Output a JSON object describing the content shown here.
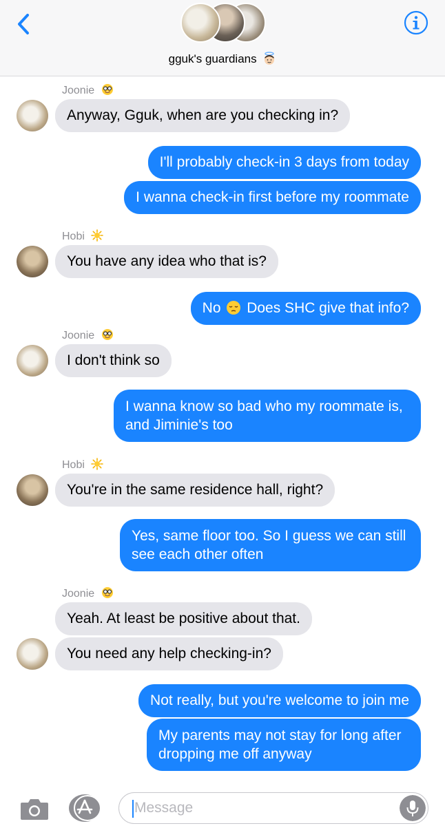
{
  "header": {
    "group_name": "gguk's guardians",
    "group_emoji": "angel-emoji",
    "back_icon": "chevron-left-icon",
    "info_icon": "info-icon"
  },
  "messages": [
    {
      "type": "sender",
      "name": "Joonie",
      "emoji": "nerd-face-emoji"
    },
    {
      "type": "in",
      "text": "Anyway, Gguk, when are you checking in?"
    },
    {
      "type": "out",
      "text": "I'll probably check-in 3 days from today"
    },
    {
      "type": "out",
      "text": "I wanna check-in first before my roommate"
    },
    {
      "type": "sender",
      "name": "Hobi",
      "emoji": "sun-emoji"
    },
    {
      "type": "in",
      "text": "You have any idea who that is?"
    },
    {
      "type": "out",
      "text_before": "No",
      "emoji": "pensive-face-emoji",
      "text_after": "Does SHC give that info?"
    },
    {
      "type": "sender",
      "name": "Joonie",
      "emoji": "nerd-face-emoji"
    },
    {
      "type": "in",
      "text": "I don't think so"
    },
    {
      "type": "out",
      "text": "I wanna know so bad who my roommate is, and Jiminie's too"
    },
    {
      "type": "sender",
      "name": "Hobi",
      "emoji": "sun-emoji"
    },
    {
      "type": "in",
      "text": "You're in the same residence hall, right?"
    },
    {
      "type": "out",
      "text": "Yes, same floor too. So I guess we can still see each other often"
    },
    {
      "type": "sender",
      "name": "Joonie",
      "emoji": "nerd-face-emoji"
    },
    {
      "type": "in",
      "text": "Yeah. At least be positive about that."
    },
    {
      "type": "in",
      "text": "You need any help checking-in?"
    },
    {
      "type": "out",
      "text": "Not really, but you're welcome to join me"
    },
    {
      "type": "out",
      "text": "My parents may not stay for long after dropping me off anyway"
    }
  ],
  "composer": {
    "placeholder": "Message",
    "camera_icon": "camera-icon",
    "apps_icon": "app-store-icon",
    "mic_icon": "microphone-icon"
  },
  "colors": {
    "outgoing_bubble": "#1a84ff",
    "incoming_bubble": "#e5e5ea",
    "accent": "#1a84ff"
  }
}
